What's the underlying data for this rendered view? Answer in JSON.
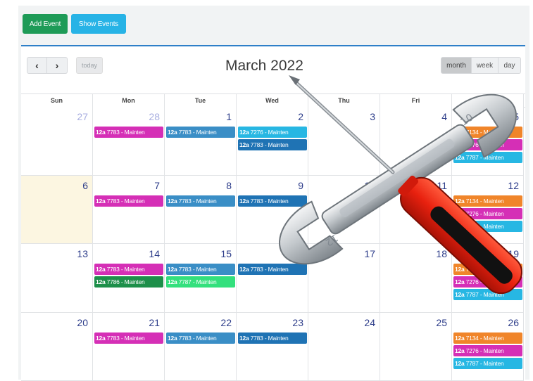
{
  "toolbar": {
    "add_label": "Add Event",
    "show_label": "Show Events"
  },
  "header": {
    "title": "March 2022",
    "prev_icon": "chevron-left-icon",
    "next_icon": "chevron-right-icon",
    "prev_glyph": "‹",
    "next_glyph": "›",
    "today_label": "today",
    "views": [
      "month",
      "week",
      "day"
    ],
    "active_view": "month"
  },
  "weekdays": [
    "Sun",
    "Mon",
    "Tue",
    "Wed",
    "Thu",
    "Fri",
    "Sat"
  ],
  "colors": {
    "magenta": "#d52fb6",
    "blue": "#3a8ec6",
    "navy": "#1f73b4",
    "cyan": "#27b7e3",
    "green": "#1d8f4a",
    "lime": "#33e07d",
    "orange": "#f0852a",
    "today_bg": "#fcf6e1",
    "accent_rule": "#2e7fc8"
  },
  "weeks": [
    [
      {
        "day": "27",
        "other": true,
        "events": []
      },
      {
        "day": "28",
        "other": true,
        "events": [
          {
            "time": "12a",
            "title": "7783 - Mainten",
            "color": "magenta"
          }
        ]
      },
      {
        "day": "1",
        "events": [
          {
            "time": "12a",
            "title": "7783 - Mainten",
            "color": "blue"
          }
        ]
      },
      {
        "day": "2",
        "events": [
          {
            "time": "12a",
            "title": "7276 - Mainten",
            "color": "cyan"
          },
          {
            "time": "12a",
            "title": "7783 - Mainten",
            "color": "navy"
          }
        ]
      },
      {
        "day": "3",
        "events": []
      },
      {
        "day": "4",
        "events": []
      },
      {
        "day": "5",
        "events": [
          {
            "time": "12a",
            "title": "7134 - Mainten",
            "color": "orange"
          },
          {
            "time": "12a",
            "title": "7276 - Mainten",
            "color": "magenta"
          },
          {
            "time": "12a",
            "title": "7787 - Mainten",
            "color": "cyan"
          }
        ]
      }
    ],
    [
      {
        "day": "6",
        "today": true,
        "events": []
      },
      {
        "day": "7",
        "events": [
          {
            "time": "12a",
            "title": "7783 - Mainten",
            "color": "magenta"
          }
        ]
      },
      {
        "day": "8",
        "events": [
          {
            "time": "12a",
            "title": "7783 - Mainten",
            "color": "blue"
          }
        ]
      },
      {
        "day": "9",
        "events": [
          {
            "time": "12a",
            "title": "7783 - Mainten",
            "color": "navy"
          }
        ]
      },
      {
        "day": "10",
        "events": []
      },
      {
        "day": "11",
        "events": []
      },
      {
        "day": "12",
        "events": [
          {
            "time": "12a",
            "title": "7134 - Mainten",
            "color": "orange"
          },
          {
            "time": "12a",
            "title": "7276 - Mainten",
            "color": "magenta"
          },
          {
            "time": "12a",
            "title": "7787 - Mainten",
            "color": "cyan"
          }
        ]
      }
    ],
    [
      {
        "day": "13",
        "events": []
      },
      {
        "day": "14",
        "events": [
          {
            "time": "12a",
            "title": "7783 - Mainten",
            "color": "magenta"
          },
          {
            "time": "12a",
            "title": "7786 - Mainten",
            "color": "green"
          }
        ]
      },
      {
        "day": "15",
        "events": [
          {
            "time": "12a",
            "title": "7783 - Mainten",
            "color": "blue"
          },
          {
            "time": "12a",
            "title": "7787 - Mainten",
            "color": "lime"
          }
        ]
      },
      {
        "day": "16",
        "events": [
          {
            "time": "12a",
            "title": "7783 - Mainten",
            "color": "navy"
          }
        ]
      },
      {
        "day": "17",
        "events": []
      },
      {
        "day": "18",
        "events": []
      },
      {
        "day": "19",
        "events": [
          {
            "time": "12a",
            "title": "7134 - Mainten",
            "color": "orange"
          },
          {
            "time": "12a",
            "title": "7276 - Mainten",
            "color": "magenta"
          },
          {
            "time": "12a",
            "title": "7787 - Mainten",
            "color": "cyan"
          }
        ]
      }
    ],
    [
      {
        "day": "20",
        "events": []
      },
      {
        "day": "21",
        "events": [
          {
            "time": "12a",
            "title": "7783 - Mainten",
            "color": "magenta"
          }
        ]
      },
      {
        "day": "22",
        "events": [
          {
            "time": "12a",
            "title": "7783 - Mainten",
            "color": "blue"
          }
        ]
      },
      {
        "day": "23",
        "events": [
          {
            "time": "12a",
            "title": "7783 - Mainten",
            "color": "navy"
          }
        ]
      },
      {
        "day": "24",
        "events": []
      },
      {
        "day": "25",
        "events": []
      },
      {
        "day": "26",
        "events": [
          {
            "time": "12a",
            "title": "7134 - Mainten",
            "color": "orange"
          },
          {
            "time": "12a",
            "title": "7276 - Mainten",
            "color": "magenta"
          },
          {
            "time": "12a",
            "title": "7787 - Mainten",
            "color": "cyan"
          }
        ]
      }
    ]
  ],
  "overlay": {
    "icon": "wrench-screwdriver-icon",
    "wrench_marks": [
      "10",
      "12"
    ]
  }
}
